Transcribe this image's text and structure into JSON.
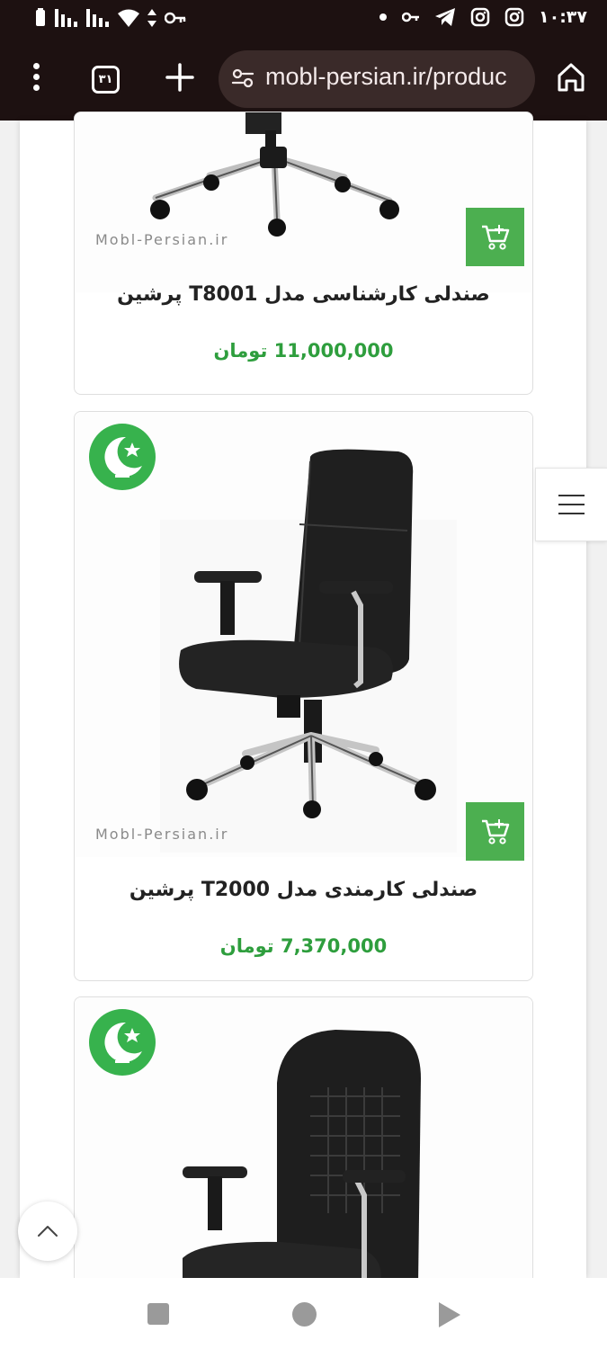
{
  "status_bar": {
    "time": "۱۰:۳۷",
    "left_icons": [
      "battery-icon",
      "signal-icon",
      "signal-icon",
      "wifi-icon",
      "data-arrows-icon",
      "vpn-key-icon"
    ],
    "right_icons": [
      "dot-icon",
      "key-icon",
      "telegram-icon",
      "instagram-icon",
      "instagram-icon"
    ]
  },
  "browser": {
    "tab_count": "۳۱",
    "url": "mobl-persian.ir/produc",
    "icons": [
      "menu-dots-icon",
      "tabs-icon",
      "new-tab-plus-icon",
      "site-settings-icon",
      "home-icon"
    ]
  },
  "products": [
    {
      "title": "صندلی کارشناسی مدل T8001 پرشین",
      "price": "11,000,000 تومان",
      "watermark": "Mobl-Persian.ir",
      "has_badge": false
    },
    {
      "title": "صندلی کارمندی مدل T2000 پرشین",
      "price": "7,370,000 تومان",
      "watermark": "Mobl-Persian.ir",
      "has_badge": true
    },
    {
      "has_badge": true
    }
  ],
  "colors": {
    "browser_bar": "#1d1111",
    "url_pill": "#3a2a29",
    "cart_green": "#4caf50",
    "price_green": "#2e9e3d",
    "badge_green": "#37b24d"
  }
}
